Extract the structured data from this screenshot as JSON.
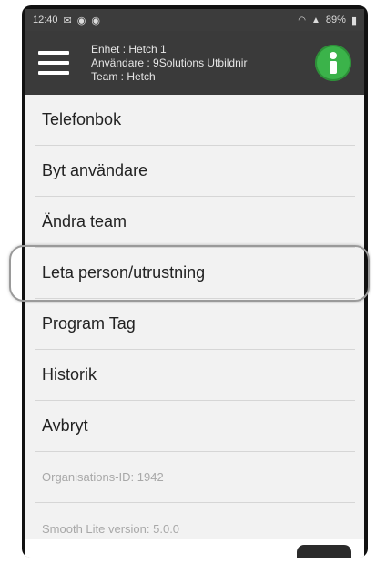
{
  "status": {
    "time": "12:40",
    "battery": "89%"
  },
  "header": {
    "unit_line": "Enhet : Hetch 1",
    "user_line": "Användare : 9Solutions Utbildnir",
    "team_line": "Team : Hetch"
  },
  "menu": {
    "items": [
      {
        "label": "Telefonbok"
      },
      {
        "label": "Byt användare"
      },
      {
        "label": "Ändra team"
      },
      {
        "label": "Leta person/utrustning"
      },
      {
        "label": "Program Tag"
      },
      {
        "label": "Historik"
      },
      {
        "label": "Avbryt"
      }
    ],
    "org_id": "Organisations-ID: 1942",
    "version": "Smooth Lite version: 5.0.0"
  },
  "colors": {
    "appbar": "#3a3a3a",
    "logo": "#3bb34a",
    "menu_bg": "#f2f2f2"
  }
}
